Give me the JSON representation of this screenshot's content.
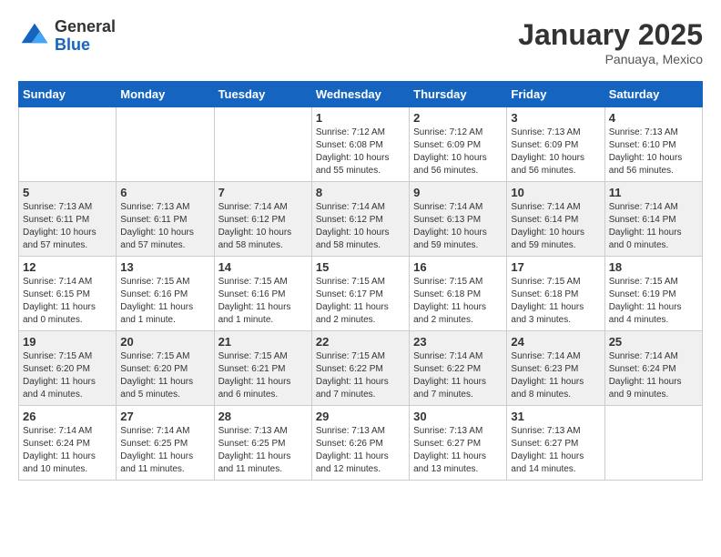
{
  "header": {
    "logo_general": "General",
    "logo_blue": "Blue",
    "month_year": "January 2025",
    "location": "Panuaya, Mexico"
  },
  "days_of_week": [
    "Sunday",
    "Monday",
    "Tuesday",
    "Wednesday",
    "Thursday",
    "Friday",
    "Saturday"
  ],
  "weeks": [
    [
      {
        "day": "",
        "info": ""
      },
      {
        "day": "",
        "info": ""
      },
      {
        "day": "",
        "info": ""
      },
      {
        "day": "1",
        "info": "Sunrise: 7:12 AM\nSunset: 6:08 PM\nDaylight: 10 hours and 55 minutes."
      },
      {
        "day": "2",
        "info": "Sunrise: 7:12 AM\nSunset: 6:09 PM\nDaylight: 10 hours and 56 minutes."
      },
      {
        "day": "3",
        "info": "Sunrise: 7:13 AM\nSunset: 6:09 PM\nDaylight: 10 hours and 56 minutes."
      },
      {
        "day": "4",
        "info": "Sunrise: 7:13 AM\nSunset: 6:10 PM\nDaylight: 10 hours and 56 minutes."
      }
    ],
    [
      {
        "day": "5",
        "info": "Sunrise: 7:13 AM\nSunset: 6:11 PM\nDaylight: 10 hours and 57 minutes."
      },
      {
        "day": "6",
        "info": "Sunrise: 7:13 AM\nSunset: 6:11 PM\nDaylight: 10 hours and 57 minutes."
      },
      {
        "day": "7",
        "info": "Sunrise: 7:14 AM\nSunset: 6:12 PM\nDaylight: 10 hours and 58 minutes."
      },
      {
        "day": "8",
        "info": "Sunrise: 7:14 AM\nSunset: 6:12 PM\nDaylight: 10 hours and 58 minutes."
      },
      {
        "day": "9",
        "info": "Sunrise: 7:14 AM\nSunset: 6:13 PM\nDaylight: 10 hours and 59 minutes."
      },
      {
        "day": "10",
        "info": "Sunrise: 7:14 AM\nSunset: 6:14 PM\nDaylight: 10 hours and 59 minutes."
      },
      {
        "day": "11",
        "info": "Sunrise: 7:14 AM\nSunset: 6:14 PM\nDaylight: 11 hours and 0 minutes."
      }
    ],
    [
      {
        "day": "12",
        "info": "Sunrise: 7:14 AM\nSunset: 6:15 PM\nDaylight: 11 hours and 0 minutes."
      },
      {
        "day": "13",
        "info": "Sunrise: 7:15 AM\nSunset: 6:16 PM\nDaylight: 11 hours and 1 minute."
      },
      {
        "day": "14",
        "info": "Sunrise: 7:15 AM\nSunset: 6:16 PM\nDaylight: 11 hours and 1 minute."
      },
      {
        "day": "15",
        "info": "Sunrise: 7:15 AM\nSunset: 6:17 PM\nDaylight: 11 hours and 2 minutes."
      },
      {
        "day": "16",
        "info": "Sunrise: 7:15 AM\nSunset: 6:18 PM\nDaylight: 11 hours and 2 minutes."
      },
      {
        "day": "17",
        "info": "Sunrise: 7:15 AM\nSunset: 6:18 PM\nDaylight: 11 hours and 3 minutes."
      },
      {
        "day": "18",
        "info": "Sunrise: 7:15 AM\nSunset: 6:19 PM\nDaylight: 11 hours and 4 minutes."
      }
    ],
    [
      {
        "day": "19",
        "info": "Sunrise: 7:15 AM\nSunset: 6:20 PM\nDaylight: 11 hours and 4 minutes."
      },
      {
        "day": "20",
        "info": "Sunrise: 7:15 AM\nSunset: 6:20 PM\nDaylight: 11 hours and 5 minutes."
      },
      {
        "day": "21",
        "info": "Sunrise: 7:15 AM\nSunset: 6:21 PM\nDaylight: 11 hours and 6 minutes."
      },
      {
        "day": "22",
        "info": "Sunrise: 7:15 AM\nSunset: 6:22 PM\nDaylight: 11 hours and 7 minutes."
      },
      {
        "day": "23",
        "info": "Sunrise: 7:14 AM\nSunset: 6:22 PM\nDaylight: 11 hours and 7 minutes."
      },
      {
        "day": "24",
        "info": "Sunrise: 7:14 AM\nSunset: 6:23 PM\nDaylight: 11 hours and 8 minutes."
      },
      {
        "day": "25",
        "info": "Sunrise: 7:14 AM\nSunset: 6:24 PM\nDaylight: 11 hours and 9 minutes."
      }
    ],
    [
      {
        "day": "26",
        "info": "Sunrise: 7:14 AM\nSunset: 6:24 PM\nDaylight: 11 hours and 10 minutes."
      },
      {
        "day": "27",
        "info": "Sunrise: 7:14 AM\nSunset: 6:25 PM\nDaylight: 11 hours and 11 minutes."
      },
      {
        "day": "28",
        "info": "Sunrise: 7:13 AM\nSunset: 6:25 PM\nDaylight: 11 hours and 11 minutes."
      },
      {
        "day": "29",
        "info": "Sunrise: 7:13 AM\nSunset: 6:26 PM\nDaylight: 11 hours and 12 minutes."
      },
      {
        "day": "30",
        "info": "Sunrise: 7:13 AM\nSunset: 6:27 PM\nDaylight: 11 hours and 13 minutes."
      },
      {
        "day": "31",
        "info": "Sunrise: 7:13 AM\nSunset: 6:27 PM\nDaylight: 11 hours and 14 minutes."
      },
      {
        "day": "",
        "info": ""
      }
    ]
  ],
  "row_shading": [
    false,
    true,
    false,
    true,
    false
  ]
}
